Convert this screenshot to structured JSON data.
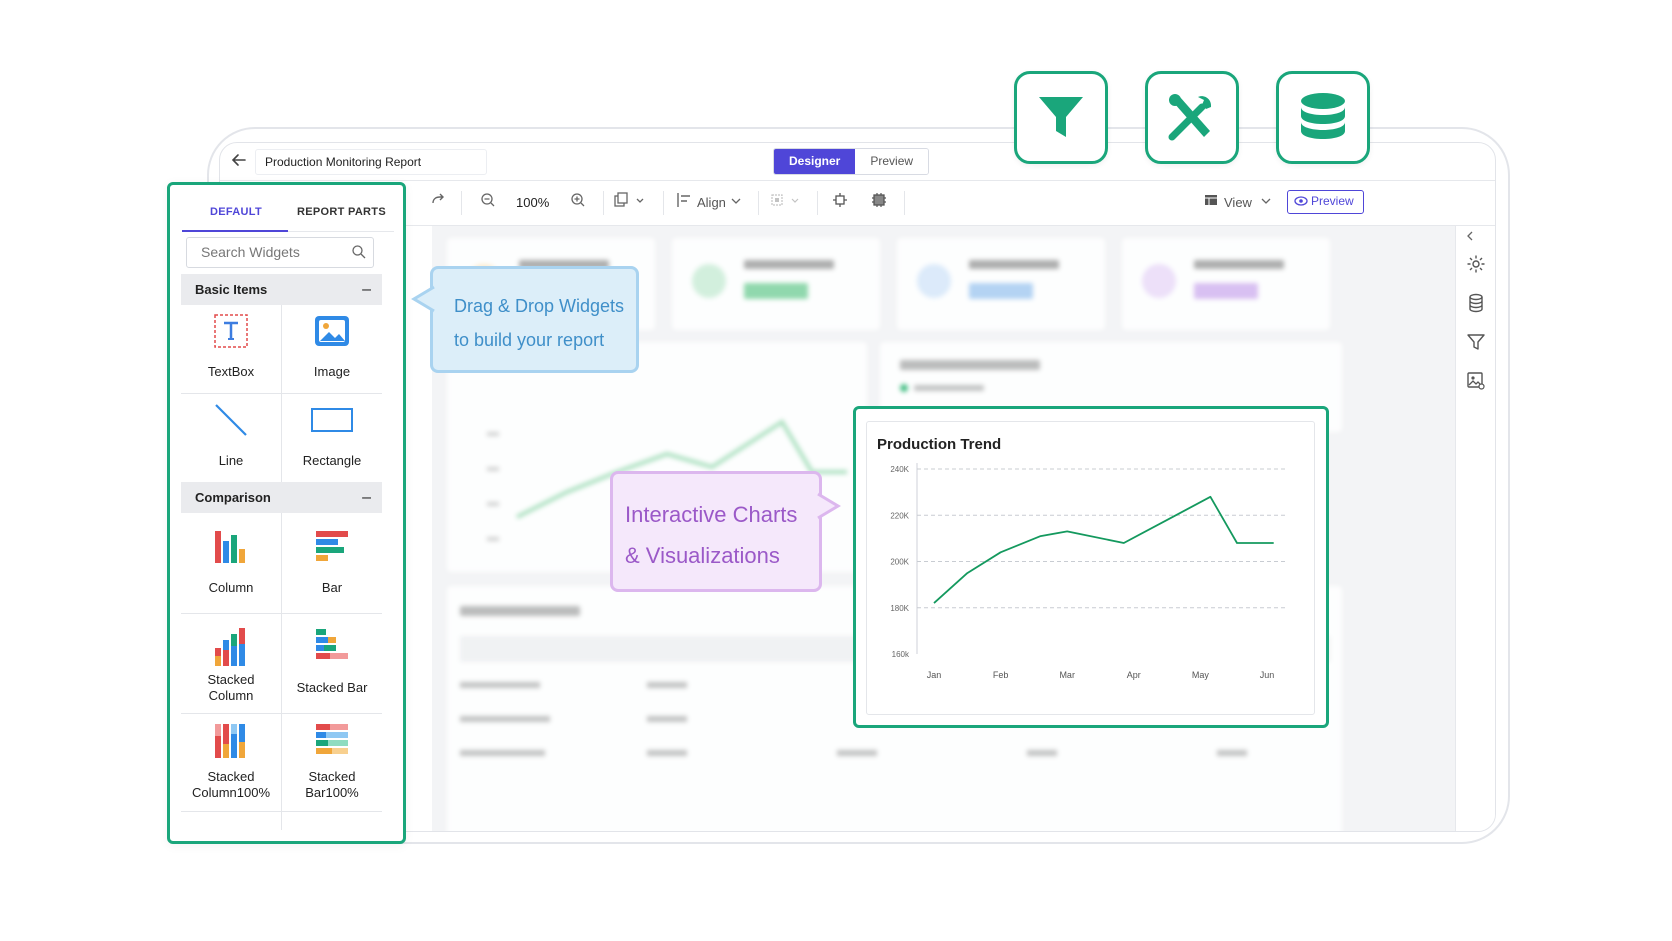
{
  "app": {
    "report_title": "Production Monitoring Report",
    "mode_designer": "Designer",
    "mode_preview": "Preview"
  },
  "toolbar": {
    "zoom": "100%",
    "align_label": "Align",
    "view_label": "View",
    "preview_label": "Preview"
  },
  "widgets_panel": {
    "tab_default": "DEFAULT",
    "tab_report_parts": "REPORT PARTS",
    "search_placeholder": "Search Widgets",
    "section_basic": "Basic Items",
    "section_comparison": "Comparison",
    "collapse_symbol": "–",
    "basic_items": [
      "TextBox",
      "Image",
      "Line",
      "Rectangle"
    ],
    "comparison_items": [
      "Column",
      "Bar",
      "Stacked\nColumn",
      "Stacked Bar",
      "Stacked\nColumn100%",
      "Stacked\nBar100%"
    ]
  },
  "callouts": {
    "drag_line1": "Drag & Drop Widgets",
    "drag_line2": "to build your report",
    "charts_line1": "Interactive Charts",
    "charts_line2": "& Visualizations"
  },
  "colors": {
    "accent_green": "#1aa67b",
    "brand_purple": "#4f46d8",
    "chart_line": "#14995e"
  },
  "feature_icons": [
    "filter-icon",
    "tools-icon",
    "database-icon"
  ],
  "chart_data": {
    "type": "line",
    "title": "Production Trend",
    "categories": [
      "Jan",
      "Feb",
      "Mar",
      "Apr",
      "May",
      "Jun"
    ],
    "y_ticks": [
      "240K",
      "220K",
      "200K",
      "180K",
      "160k"
    ],
    "y_tick_values": [
      240000,
      220000,
      200000,
      180000,
      160000
    ],
    "ylim": [
      160000,
      240000
    ],
    "series": [
      {
        "values": [
          182000,
          195000,
          204000,
          211000,
          213000,
          208000,
          218000,
          228000,
          208000,
          208000
        ],
        "x_positions": [
          0,
          0.5,
          1,
          1.6,
          2,
          2.85,
          3.5,
          4.15,
          4.55,
          5.1
        ]
      }
    ],
    "grid": true
  }
}
